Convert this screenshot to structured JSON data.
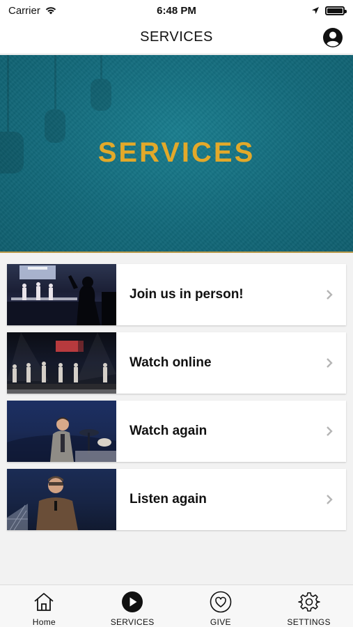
{
  "status_bar": {
    "carrier": "Carrier",
    "time": "6:48 PM"
  },
  "nav": {
    "title": "SERVICES"
  },
  "hero": {
    "title": "SERVICES",
    "title_color": "#e2a92a",
    "background_color": "#12697a"
  },
  "list": {
    "items": [
      {
        "label": "Join us in person!"
      },
      {
        "label": "Watch online"
      },
      {
        "label": "Watch again"
      },
      {
        "label": "Listen again"
      }
    ]
  },
  "tabs": [
    {
      "label": "Home",
      "icon": "home-icon"
    },
    {
      "label": "SERVICES",
      "icon": "play-icon",
      "active": true
    },
    {
      "label": "GIVE",
      "icon": "heart-icon"
    },
    {
      "label": "SETTINGS",
      "icon": "gear-icon"
    }
  ]
}
